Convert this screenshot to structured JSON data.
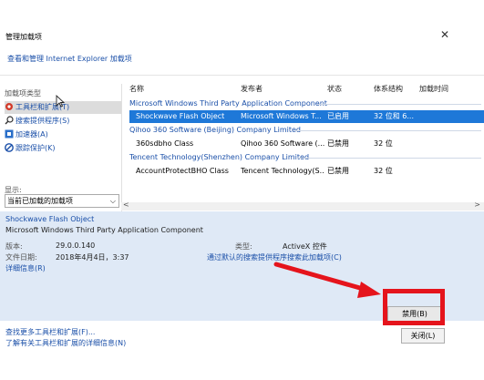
{
  "window": {
    "title": "管理加载项",
    "subtitle": "查看和管理 Internet Explorer 加载项"
  },
  "left_pane": {
    "type_label": "加载项类型",
    "items": [
      {
        "label": "工具栏和扩展(T)",
        "icon": "gear-icon",
        "selected": true
      },
      {
        "label": "搜索提供程序(S)",
        "icon": "search-icon",
        "selected": false
      },
      {
        "label": "加速器(A)",
        "icon": "accelerator-icon",
        "selected": false
      },
      {
        "label": "跟踪保护(K)",
        "icon": "tracking-protection-icon",
        "selected": false
      }
    ],
    "show_label": "显示:",
    "show_value": "当前已加载的加载项"
  },
  "table": {
    "columns": [
      "名称",
      "发布者",
      "状态",
      "体系结构",
      "加载时间"
    ],
    "groups": [
      {
        "name": "Microsoft Windows Third Party Application Component",
        "rows": [
          {
            "name": "Shockwave Flash Object",
            "publisher": "Microsoft Windows T...",
            "status": "已启用",
            "arch": "32 位和 6...",
            "selected": true
          }
        ]
      },
      {
        "name": "Qihoo 360 Software (Beijing) Company Limited",
        "rows": [
          {
            "name": "360sdbho Class",
            "publisher": "Qihoo 360 Software (...",
            "status": "已禁用",
            "arch": "32 位",
            "selected": false
          }
        ]
      },
      {
        "name": "Tencent Technology(Shenzhen) Company Limited",
        "rows": [
          {
            "name": "AccountProtectBHO Class",
            "publisher": "Tencent Technology(S...",
            "status": "已禁用",
            "arch": "32 位",
            "selected": false
          }
        ]
      }
    ]
  },
  "details": {
    "name": "Shockwave Flash Object",
    "publisher": "Microsoft Windows Third Party Application Component",
    "version_label": "版本:",
    "version_value": "29.0.0.140",
    "date_label": "文件日期:",
    "date_value": "2018年4月4日，3:37",
    "more_info": "详细信息(R)",
    "type_label": "类型:",
    "type_value": "ActiveX 控件",
    "search_link": "通过默认的搜索提供程序搜索此加载项(C)"
  },
  "footer": {
    "find_more": "查找更多工具栏和扩展(F)...",
    "learn_more": "了解有关工具栏和扩展的详细信息(N)",
    "disable_button": "禁用(B)",
    "close_button": "关闭(L)"
  },
  "colors": {
    "link": "#1a4fa8",
    "selection": "#1e78d8",
    "highlight_red": "#e5141c",
    "details_bg": "#dfe9f6"
  }
}
